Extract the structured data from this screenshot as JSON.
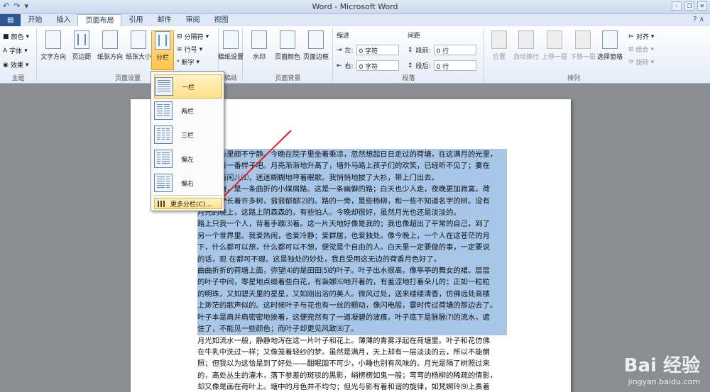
{
  "window": {
    "title": "Word - Microsoft Word"
  },
  "tabs": [
    "开始",
    "插入",
    "页面布局",
    "引用",
    "邮件",
    "审阅",
    "视图"
  ],
  "ribbon": {
    "theme_group": {
      "label": "主题",
      "buttons": [
        "颜色",
        "字体",
        "效果"
      ]
    },
    "page_setup": {
      "label": "页面设置",
      "buttons": [
        "文字方向",
        "页边距",
        "纸张方向",
        "纸张大小",
        "分栏"
      ],
      "small": [
        "分隔符",
        "行号",
        "断字"
      ]
    },
    "draft_group": {
      "label": "稿纸",
      "button": "稿纸设置"
    },
    "page_bg": {
      "label": "页面背景",
      "buttons": [
        "水印",
        "页面颜色",
        "页面边框"
      ]
    },
    "paragraph": {
      "label": "段落",
      "indent_title": "缩进",
      "spacing_title": "间距",
      "left_label": "左:",
      "left_value": "0 字符",
      "right_label": "右:",
      "right_value": "0 字符",
      "before_label": "段前:",
      "before_value": "0 行",
      "after_label": "段后:",
      "after_value": "0 行"
    },
    "arrange": {
      "label": "排列",
      "buttons": [
        "位置",
        "自动换行",
        "上移一层",
        "下移一层",
        "选择窗格"
      ],
      "small": [
        "对齐",
        "组合",
        "旋转"
      ]
    }
  },
  "columns_menu": {
    "items": [
      "一栏",
      "两栏",
      "三栏",
      "偏左",
      "偏右"
    ],
    "more": "更多分栏(C)..."
  },
  "document": {
    "selected_lines": [
      "这几天心里颇不宁静。今晚在院子里坐着乘凉，忽然想起日日走过的荷塘，在这满月的光里，",
      "总该另有一番样子吧。月亮渐渐地升高了，墙外马路上孩子们的欢笑，已经听不见了；妻在",
      "屋里拍着闰儿⑴，迷迷糊糊地哼着眠歌。我悄悄地披了大衫，带上门出去。",
      "沿着荷塘，是一条曲折的小煤屑路。这是一条幽僻的路；白天也少人走，夜晚更加寂寞。荷",
      "塘四面，长着许多树，蓊蓊郁郁⑵的。路的一旁，是些杨柳，和一些不知道名字的树。没有",
      "月光的晚上，这路上阴森森的，有些怕人。今晚却很好，虽然月光也还是淡淡的。",
      "路上只我一个人，背着手踱⑶着。这一片天地好像是我的；我也像超出了平常的自己，到了",
      "另一个世界里。我爱热闹，也爱冷静；爱群居，也爱独处。像今晚上，一个人在这苍茫的月",
      "下，什么都可以想，什么都可以不想，便觉是个自由的人。白天里一定要做的事，一定要说",
      "的话，现 在都可不理。这是独处的妙处，我且受用这无边的荷香月色好了。",
      "曲曲折折的荷塘上面，弥望⑷的是田田⑸的叶子。叶子出水很高，像亭亭的舞女的裙。层层",
      "的叶子中间，零星地点缀着些白花，有袅娜⑹地开着的，有羞涩地打着朵儿的；正如一粒粒",
      "的明珠，又如碧天里的星星，又如刚出浴的美人。微风过处，送来缕缕清香，仿佛远处高楼",
      "上渺茫的歌声似的。这时候叶子与花也有一丝的颤动，像闪电般，霎时传过荷塘的那边去了。",
      "叶子本是肩并肩密密地挨着，这便宛然有了一道凝碧的波痕。叶子底下是脉脉⑺的流水，遮",
      "住了，不能见一些颜色；而叶子却更见风致⑻了。"
    ],
    "normal_lines": [
      "月光如流水一般，静静地泻在这一片叶子和花上。薄薄的青雾浮起在荷塘里。叶子和花仿佛",
      "在牛乳中洗过一样；又像笼着轻纱的梦。虽然是满月，天上却有一层淡淡的云，所以不能朗",
      "照；但我以为这恰是到了好处——酣眠固不可少，小睡也别有风味的。月光是隔了树照过来",
      "的，高处丛生的灌木，落下参差的斑驳的黑影，峭楞楞如鬼一般；弯弯的杨柳的稀疏的倩影，",
      "却又像是画在荷叶上。塘中的月色并不均匀；但光与影有着和谐的旋律，如梵婀玲⑼上奏着"
    ]
  },
  "watermark": {
    "line1": "Bai 经验",
    "line2": "jingyan.baidu.com"
  }
}
